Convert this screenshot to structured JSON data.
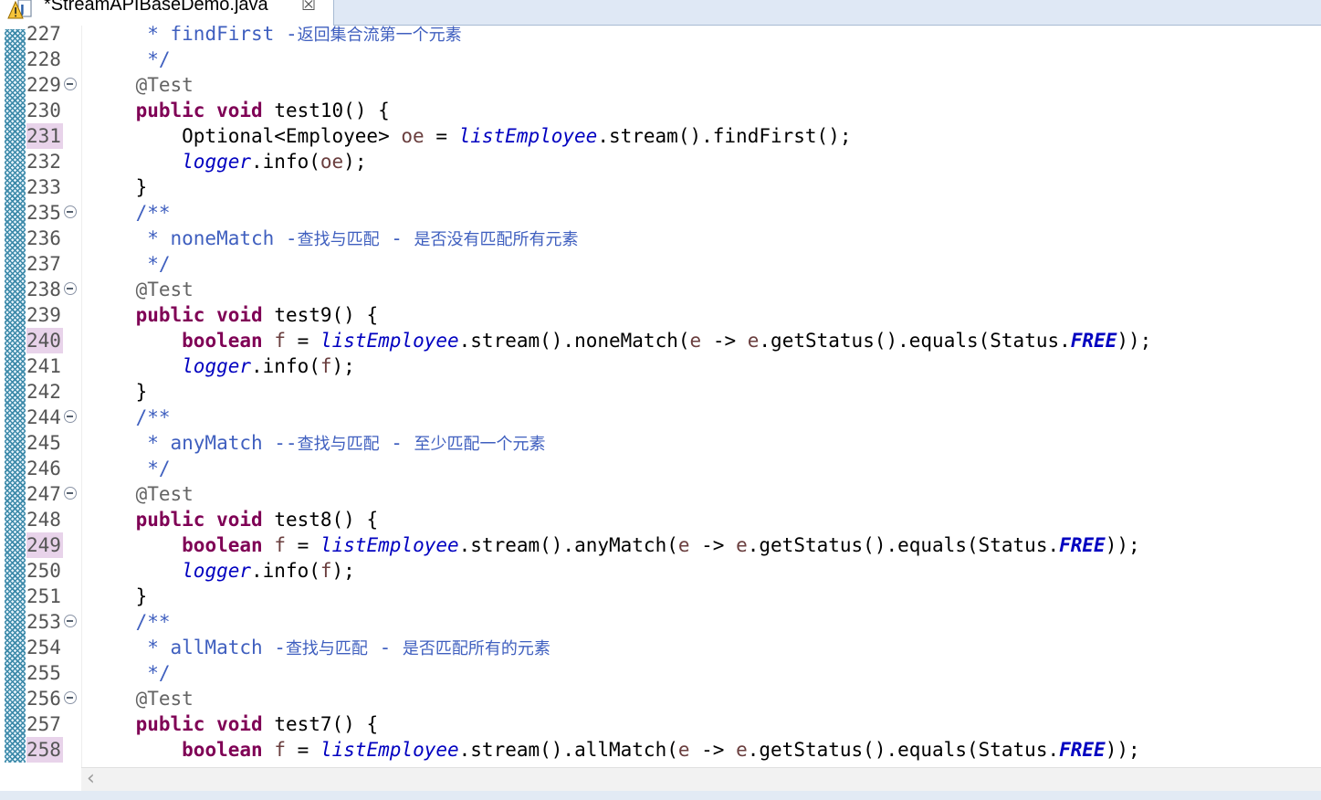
{
  "tab": {
    "title": "*StreamAPIBaseDemo.java",
    "icon": "java-file-warning-icon",
    "close_symbol": "☒"
  },
  "scroll": {
    "left_arrow": "‹"
  },
  "colors": {
    "keyword": "#7f0055",
    "javadoc": "#3f5fbf",
    "field": "#0000c0",
    "annotation": "#646464",
    "local_variable": "#6a3e3e",
    "line_highlight": "#e8d3ea"
  },
  "lines": [
    {
      "num": "227",
      "fold": false,
      "hl": false,
      "parts": [
        [
          "doc",
          "     * "
        ],
        [
          "doc",
          "findFirst "
        ],
        [
          "doc",
          "-"
        ],
        [
          "cn",
          "返回集合流第一个元素"
        ]
      ]
    },
    {
      "num": "228",
      "fold": false,
      "hl": false,
      "parts": [
        [
          "doc",
          "     */"
        ]
      ]
    },
    {
      "num": "229",
      "fold": true,
      "hl": false,
      "parts": [
        [
          "ann",
          "    @Test"
        ]
      ]
    },
    {
      "num": "230",
      "fold": false,
      "hl": false,
      "parts": [
        [
          "plain",
          "    "
        ],
        [
          "kw",
          "public"
        ],
        [
          "plain",
          " "
        ],
        [
          "kw",
          "void"
        ],
        [
          "plain",
          " test10() {"
        ]
      ]
    },
    {
      "num": "231",
      "fold": false,
      "hl": true,
      "parts": [
        [
          "plain",
          "        Optional<Employee> "
        ],
        [
          "var",
          "oe"
        ],
        [
          "plain",
          " = "
        ],
        [
          "fld",
          "listEmployee"
        ],
        [
          "plain",
          ".stream().findFirst();"
        ]
      ]
    },
    {
      "num": "232",
      "fold": false,
      "hl": false,
      "parts": [
        [
          "plain",
          "        "
        ],
        [
          "fld",
          "logger"
        ],
        [
          "plain",
          ".info("
        ],
        [
          "var",
          "oe"
        ],
        [
          "plain",
          ");"
        ]
      ]
    },
    {
      "num": "233",
      "fold": false,
      "hl": false,
      "parts": [
        [
          "plain",
          "    }"
        ]
      ]
    },
    {
      "num": "235",
      "fold": true,
      "hl": false,
      "parts": [
        [
          "doc",
          "    /**"
        ]
      ]
    },
    {
      "num": "236",
      "fold": false,
      "hl": false,
      "parts": [
        [
          "doc",
          "     * noneMatch -"
        ],
        [
          "cn",
          "查找与匹配"
        ],
        [
          "doc",
          " - "
        ],
        [
          "cn",
          "是否没有匹配所有元素"
        ]
      ]
    },
    {
      "num": "237",
      "fold": false,
      "hl": false,
      "parts": [
        [
          "doc",
          "     */"
        ]
      ]
    },
    {
      "num": "238",
      "fold": true,
      "hl": false,
      "parts": [
        [
          "ann",
          "    @Test"
        ]
      ]
    },
    {
      "num": "239",
      "fold": false,
      "hl": false,
      "parts": [
        [
          "plain",
          "    "
        ],
        [
          "kw",
          "public"
        ],
        [
          "plain",
          " "
        ],
        [
          "kw",
          "void"
        ],
        [
          "plain",
          " test9() {"
        ]
      ]
    },
    {
      "num": "240",
      "fold": false,
      "hl": true,
      "parts": [
        [
          "plain",
          "        "
        ],
        [
          "kw",
          "boolean"
        ],
        [
          "plain",
          " "
        ],
        [
          "var",
          "f"
        ],
        [
          "plain",
          " = "
        ],
        [
          "fld",
          "listEmployee"
        ],
        [
          "plain",
          ".stream().noneMatch("
        ],
        [
          "var",
          "e"
        ],
        [
          "plain",
          " -> "
        ],
        [
          "var",
          "e"
        ],
        [
          "plain",
          ".getStatus().equals(Status."
        ],
        [
          "const",
          "FREE"
        ],
        [
          "plain",
          "));"
        ]
      ]
    },
    {
      "num": "241",
      "fold": false,
      "hl": false,
      "parts": [
        [
          "plain",
          "        "
        ],
        [
          "fld",
          "logger"
        ],
        [
          "plain",
          ".info("
        ],
        [
          "var",
          "f"
        ],
        [
          "plain",
          ");"
        ]
      ]
    },
    {
      "num": "242",
      "fold": false,
      "hl": false,
      "parts": [
        [
          "plain",
          "    }"
        ]
      ]
    },
    {
      "num": "244",
      "fold": true,
      "hl": false,
      "parts": [
        [
          "doc",
          "    /**"
        ]
      ]
    },
    {
      "num": "245",
      "fold": false,
      "hl": false,
      "parts": [
        [
          "doc",
          "     * anyMatch --"
        ],
        [
          "cn",
          "查找与匹配"
        ],
        [
          "doc",
          " - "
        ],
        [
          "cn",
          "至少匹配一个元素"
        ]
      ]
    },
    {
      "num": "246",
      "fold": false,
      "hl": false,
      "parts": [
        [
          "doc",
          "     */"
        ]
      ]
    },
    {
      "num": "247",
      "fold": true,
      "hl": false,
      "parts": [
        [
          "ann",
          "    @Test"
        ]
      ]
    },
    {
      "num": "248",
      "fold": false,
      "hl": false,
      "parts": [
        [
          "plain",
          "    "
        ],
        [
          "kw",
          "public"
        ],
        [
          "plain",
          " "
        ],
        [
          "kw",
          "void"
        ],
        [
          "plain",
          " test8() {"
        ]
      ]
    },
    {
      "num": "249",
      "fold": false,
      "hl": true,
      "parts": [
        [
          "plain",
          "        "
        ],
        [
          "kw",
          "boolean"
        ],
        [
          "plain",
          " "
        ],
        [
          "var",
          "f"
        ],
        [
          "plain",
          " = "
        ],
        [
          "fld",
          "listEmployee"
        ],
        [
          "plain",
          ".stream().anyMatch("
        ],
        [
          "var",
          "e"
        ],
        [
          "plain",
          " -> "
        ],
        [
          "var",
          "e"
        ],
        [
          "plain",
          ".getStatus().equals(Status."
        ],
        [
          "const",
          "FREE"
        ],
        [
          "plain",
          "));"
        ]
      ]
    },
    {
      "num": "250",
      "fold": false,
      "hl": false,
      "parts": [
        [
          "plain",
          "        "
        ],
        [
          "fld",
          "logger"
        ],
        [
          "plain",
          ".info("
        ],
        [
          "var",
          "f"
        ],
        [
          "plain",
          ");"
        ]
      ]
    },
    {
      "num": "251",
      "fold": false,
      "hl": false,
      "parts": [
        [
          "plain",
          "    }"
        ]
      ]
    },
    {
      "num": "253",
      "fold": true,
      "hl": false,
      "parts": [
        [
          "doc",
          "    /**"
        ]
      ]
    },
    {
      "num": "254",
      "fold": false,
      "hl": false,
      "parts": [
        [
          "doc",
          "     * allMatch -"
        ],
        [
          "cn",
          "查找与匹配"
        ],
        [
          "doc",
          " - "
        ],
        [
          "cn",
          "是否匹配所有的元素"
        ]
      ]
    },
    {
      "num": "255",
      "fold": false,
      "hl": false,
      "parts": [
        [
          "doc",
          "     */"
        ]
      ]
    },
    {
      "num": "256",
      "fold": true,
      "hl": false,
      "parts": [
        [
          "ann",
          "    @Test"
        ]
      ]
    },
    {
      "num": "257",
      "fold": false,
      "hl": false,
      "parts": [
        [
          "plain",
          "    "
        ],
        [
          "kw",
          "public"
        ],
        [
          "plain",
          " "
        ],
        [
          "kw",
          "void"
        ],
        [
          "plain",
          " test7() {"
        ]
      ]
    },
    {
      "num": "258",
      "fold": false,
      "hl": true,
      "parts": [
        [
          "plain",
          "        "
        ],
        [
          "kw",
          "boolean"
        ],
        [
          "plain",
          " "
        ],
        [
          "var",
          "f"
        ],
        [
          "plain",
          " = "
        ],
        [
          "fld",
          "listEmployee"
        ],
        [
          "plain",
          ".stream().allMatch("
        ],
        [
          "var",
          "e"
        ],
        [
          "plain",
          " -> "
        ],
        [
          "var",
          "e"
        ],
        [
          "plain",
          ".getStatus().equals(Status."
        ],
        [
          "const",
          "FREE"
        ],
        [
          "plain",
          "));"
        ]
      ]
    }
  ]
}
